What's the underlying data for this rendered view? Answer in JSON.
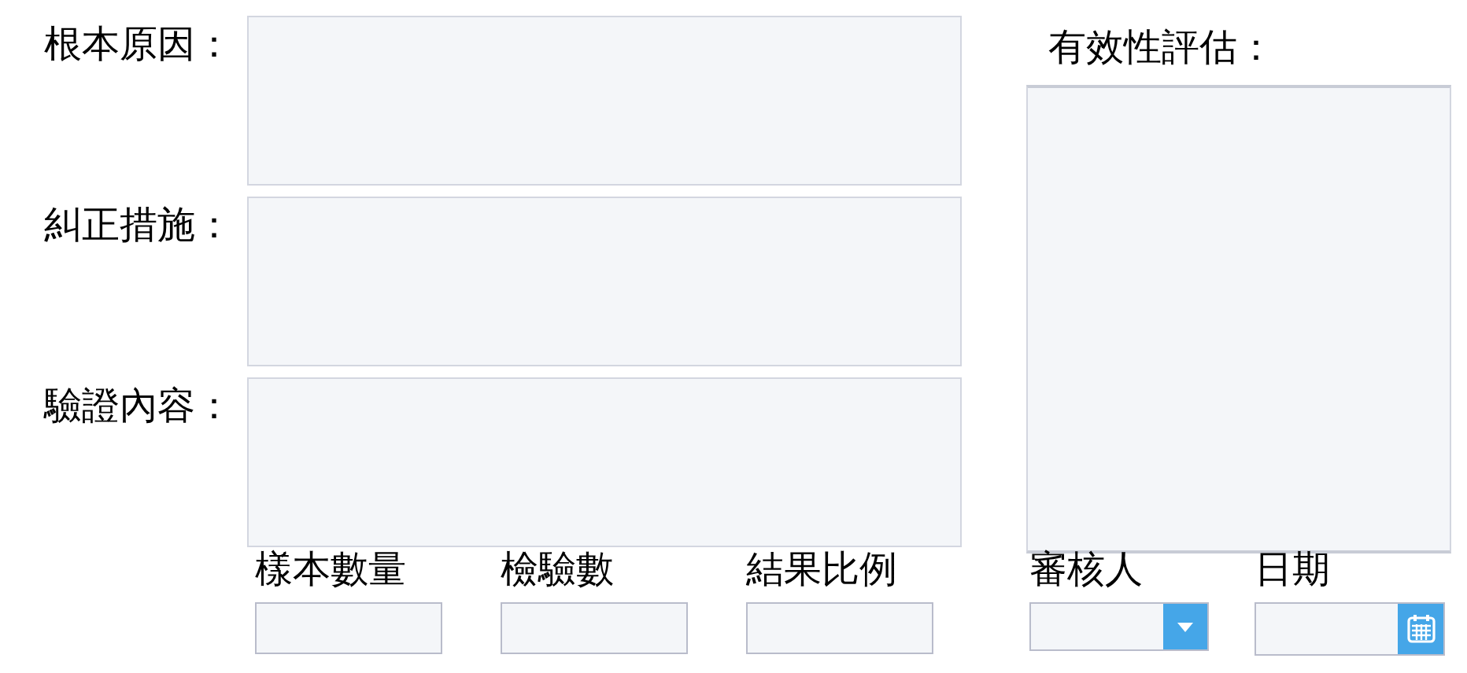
{
  "text_areas": [
    {
      "label": "根本原因："
    },
    {
      "label": "糾正措施："
    },
    {
      "label": "驗證內容："
    }
  ],
  "evaluation": {
    "label": "有效性評估："
  },
  "bottom_fields": [
    {
      "label": "樣本數量",
      "kind": "text"
    },
    {
      "label": "檢驗數",
      "kind": "text"
    },
    {
      "label": "結果比例",
      "kind": "text"
    },
    {
      "label": "審核人",
      "kind": "select"
    },
    {
      "label": "日期",
      "kind": "date"
    }
  ]
}
